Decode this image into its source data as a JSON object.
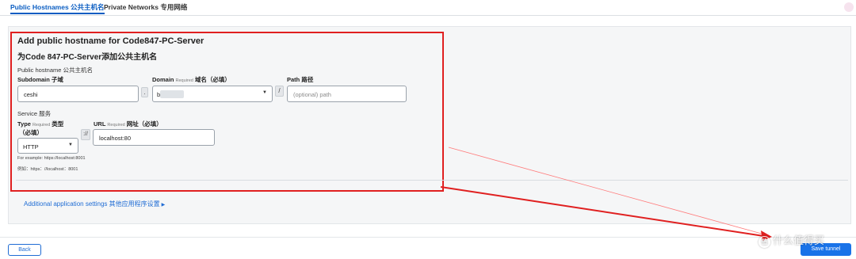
{
  "tabs": [
    {
      "label": "Public Hostnames 公共主机名",
      "active": true
    },
    {
      "label": "Private Networks 专用网络",
      "active": false
    }
  ],
  "form": {
    "title_en": "Add public hostname for Code847-PC-Server",
    "title_zh": "为Code 847-PC-Server添加公共主机名",
    "public_hostname_section": "Public hostname 公共主机名",
    "subdomain": {
      "label": "Subdomain 子域",
      "value": "ceshi"
    },
    "dot_separator": ".",
    "domain": {
      "label": "Domain",
      "required": "Required",
      "label_zh": "域名（必填）",
      "value": "b"
    },
    "slash_separator": "/",
    "path": {
      "label": "Path 路径",
      "placeholder": "(optional) path"
    },
    "service_section": "Service 服务",
    "type": {
      "label": "Type",
      "required": "Required",
      "label_zh_1": "类型",
      "label_zh_2": "（必填）",
      "value": "HTTP"
    },
    "scheme_separator": "://",
    "url": {
      "label": "URL",
      "required": "Required",
      "label_zh": "网址（必填）",
      "value": "localhost:80"
    },
    "help_en": "For example: https://localhost:8001",
    "help_zh": "例如：https：//localhost：8001",
    "additional_settings": "Additional application settings 其他应用程序设置"
  },
  "footer": {
    "back_label": "Back",
    "save_label": "Save tunnel"
  },
  "watermark": {
    "icon_glyph": "值",
    "text": "什么值得买"
  },
  "colors": {
    "accent": "#1a73e8",
    "highlight_border": "#e02020",
    "arrow": "#e02020"
  }
}
